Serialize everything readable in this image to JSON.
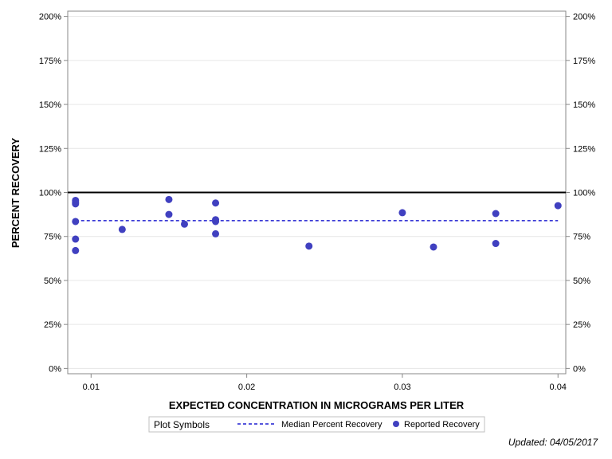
{
  "chart_data": {
    "type": "scatter",
    "xlabel": "EXPECTED CONCENTRATION IN MICROGRAMS PER LITER",
    "ylabel": "PERCENT RECOVERY",
    "xlim": [
      0.0085,
      0.0405
    ],
    "ylim": [
      -3,
      203
    ],
    "x_ticks": [
      0.01,
      0.02,
      0.03,
      0.04
    ],
    "x_tick_labels": [
      "0.01",
      "0.02",
      "0.03",
      "0.04"
    ],
    "y_ticks": [
      0,
      25,
      50,
      75,
      100,
      125,
      150,
      175,
      200
    ],
    "y_tick_labels": [
      "0%",
      "25%",
      "50%",
      "75%",
      "100%",
      "125%",
      "150%",
      "175%",
      "200%"
    ],
    "grid": "horizontal",
    "reference_line": {
      "y": 100,
      "color": "#000000"
    },
    "median_line": {
      "name": "Median Percent Recovery",
      "y": 84,
      "x_range": [
        0.009,
        0.04
      ],
      "color": "#1f1fd0",
      "style": "dashed"
    },
    "series": [
      {
        "name": "Reported Recovery",
        "color": "#4040c0",
        "points": [
          {
            "x": 0.009,
            "y": 95.5
          },
          {
            "x": 0.009,
            "y": 94.5
          },
          {
            "x": 0.009,
            "y": 93.5
          },
          {
            "x": 0.009,
            "y": 83.5
          },
          {
            "x": 0.009,
            "y": 73.5
          },
          {
            "x": 0.009,
            "y": 67
          },
          {
            "x": 0.012,
            "y": 79
          },
          {
            "x": 0.015,
            "y": 96
          },
          {
            "x": 0.015,
            "y": 87.5
          },
          {
            "x": 0.016,
            "y": 82
          },
          {
            "x": 0.018,
            "y": 94
          },
          {
            "x": 0.018,
            "y": 84.5
          },
          {
            "x": 0.018,
            "y": 83.5
          },
          {
            "x": 0.018,
            "y": 76.5
          },
          {
            "x": 0.024,
            "y": 69.5
          },
          {
            "x": 0.03,
            "y": 88.5
          },
          {
            "x": 0.032,
            "y": 69
          },
          {
            "x": 0.036,
            "y": 88
          },
          {
            "x": 0.036,
            "y": 71
          },
          {
            "x": 0.04,
            "y": 92.5
          }
        ]
      }
    ],
    "legend": {
      "title": "Plot Symbols",
      "items": [
        "Median Percent Recovery",
        "Reported Recovery"
      ],
      "placement": "bottom"
    }
  },
  "footer": {
    "updated": "Updated: 04/05/2017"
  }
}
